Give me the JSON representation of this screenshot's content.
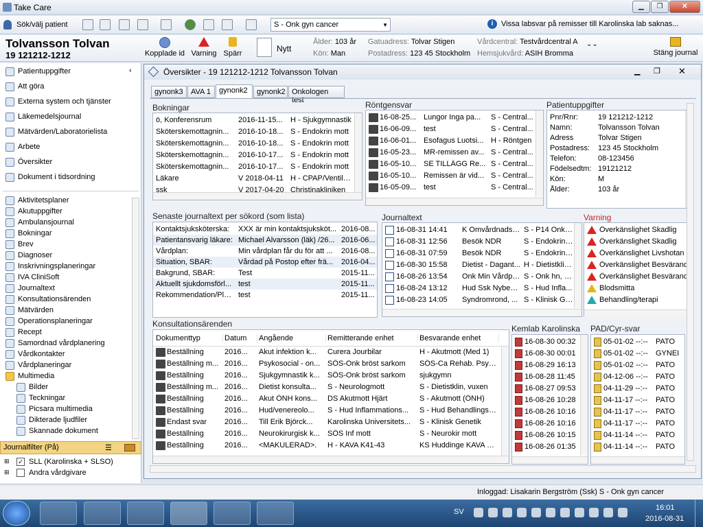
{
  "app": {
    "title": "Take Care"
  },
  "toolbar": {
    "search_patient": "Sök/välj patient",
    "unit": "S - Onk gyn cancer",
    "notice": "Vissa labsvar på remisser till Karolinska lab saknas..."
  },
  "patient": {
    "name": "Tolvansson Tolvan",
    "pnr": "19 121212-1212",
    "linked_id": "Kopplade id",
    "warning": "Varning",
    "lock": "Spärr",
    "new": "Nytt",
    "age_label": "Ålder:",
    "age": "103 år",
    "sex_label": "Kön:",
    "sex": "Man",
    "street_label": "Gatuadress:",
    "street": "Tolvar Stigen",
    "postal_label": "Postadress:",
    "postal": "123 45 Stockholm",
    "center_label": "Vårdcentral:",
    "center": "Testvårdcentral A",
    "home_label": "Hemsjukvård:",
    "home": "ASIH Bromma",
    "close": "Stäng journal"
  },
  "sidebar": {
    "top": [
      "Patientuppgifter",
      "Att göra",
      "Externa system och tjänster",
      "Läkemedelsjournal",
      "Mätvärden/Laboratorielista",
      "Arbete",
      "Översikter",
      "Dokument i tidsordning"
    ],
    "list": [
      "Aktivitetsplaner",
      "Akutuppgifter",
      "Ambulansjournal",
      "Bokningar",
      "Brev",
      "Diagnoser",
      "Inskrivningsplaneringar",
      "IVA CliniSoft",
      "Journaltext",
      "Konsultationsärenden",
      "Mätvärden",
      "Operationsplaneringar",
      "Recept",
      "Samordnad vårdplanering",
      "Vårdkontakter",
      "Vårdplaneringar",
      "Multimedia"
    ],
    "sub": [
      "Bilder",
      "Teckningar",
      "Picsara multimedia",
      "Dikterade ljudfiler",
      "Skannade dokument"
    ],
    "filter_title": "Journalfilter (På)",
    "filters": [
      "SLL (Karolinska + SLSO)",
      "Andra vårdgivare"
    ]
  },
  "window": {
    "title": "Översikter - 19 121212-1212 Tolvansson Tolvan",
    "tabs": [
      "gynonk3",
      "AVA 1",
      "gynonk2",
      "gynonk2",
      "Onkologen test"
    ]
  },
  "bokningar": {
    "title": "Bokningar",
    "rows": [
      [
        "ö, Konferensrum",
        "2016-11-15...",
        "H - Sjukgymnastik"
      ],
      [
        "Sköterskemottagnin...",
        "2016-10-18...",
        "S - Endokrin mott"
      ],
      [
        "Sköterskemottagnin...",
        "2016-10-18...",
        "S - Endokrin mott"
      ],
      [
        "Sköterskemottagnin...",
        "2016-10-17...",
        "S - Endokrin mott"
      ],
      [
        "Sköterskemottagnin...",
        "2016-10-17...",
        "S - Endokrin mott"
      ],
      [
        "Läkare",
        "V 2018-04-11",
        "H - CPAP/Ventila..."
      ],
      [
        "ssk",
        "V 2017-04-20",
        "Christinakliniken"
      ]
    ]
  },
  "rontgen": {
    "title": "Röntgensvar",
    "rows": [
      [
        "16-08-25...",
        "Lungor Inga pa...",
        "S - Central..."
      ],
      [
        "16-06-09...",
        "test",
        "S - Central..."
      ],
      [
        "16-06-01...",
        "Esofagus Luotsi...",
        "H - Röntgen"
      ],
      [
        "16-05-23...",
        "MR-remissen av...",
        "S - Central..."
      ],
      [
        "16-05-10...",
        "SE TILLÄGG Re...",
        "S - Central..."
      ],
      [
        "16-05-10...",
        "Remissen är vid...",
        "S - Central..."
      ],
      [
        "16-05-09...",
        "test",
        "S - Central..."
      ]
    ]
  },
  "patientinfo": {
    "title": "Patientuppgifter",
    "rows": [
      [
        "Pnr/Rnr:",
        "19  121212-1212"
      ],
      [
        "Namn:",
        "Tolvansson Tolvan"
      ],
      [
        "Adress",
        "Tolvar Stigen"
      ],
      [
        "Postadress:",
        "123 45 Stockholm"
      ],
      [
        "Telefon:",
        "08-123456"
      ],
      [
        "Födelsedtm:",
        "19121212"
      ],
      [
        "Kön:",
        "M"
      ],
      [
        "Ålder:",
        "103 år"
      ]
    ]
  },
  "senaste": {
    "title": "Senaste journaltext per sökord (som lista)",
    "rows": [
      [
        "Kontaktsjuksköterska:",
        "XXX är min kontaktsjuksköt...",
        "2016-08..."
      ],
      [
        "Patientansvarig läkare:",
        "Michael Alvarsson (läk) /26...",
        "2016-06..."
      ],
      [
        "Vårdplan:",
        "Min vårdplan får du för att ...",
        "2016-08..."
      ],
      [
        "Situation, SBAR:",
        "Vårdad på Postop efter frä...",
        "2016-04..."
      ],
      [
        "Bakgrund, SBAR:",
        "Test",
        "2015-11..."
      ],
      [
        "Aktuellt sjukdomsförl...",
        "test",
        "2015-11..."
      ],
      [
        "Rekommendation/Pla...",
        "test",
        "2015-11..."
      ]
    ]
  },
  "journaltext": {
    "title": "Journaltext",
    "rows": [
      [
        "16-08-31 14:41",
        "K Omvårdnadsa...",
        "S - P14 Onkol..."
      ],
      [
        "16-08-31 12:56",
        "Besök NDR",
        "S - Endokrin ..."
      ],
      [
        "16-08-31 07:59",
        "Besök NDR",
        "S - Endokrin ..."
      ],
      [
        "16-08-30 15:58",
        "Dietist - Dagant...",
        "H - Dietistklin..."
      ],
      [
        "16-08-26 13:54",
        "Onk Min Vårdplan",
        "S - Onk hn, lu..."
      ],
      [
        "16-08-24 13:12",
        "Hud Ssk Nybesök",
        "S - Hud Infla..."
      ],
      [
        "16-08-23 14:05",
        "Syndromrond, ...",
        "S - Klinisk Gen..."
      ]
    ]
  },
  "varning": {
    "title": "Varning",
    "rows": [
      "Överkänslighet Skadlig",
      "Överkänslighet Skadlig",
      "Överkänslighet Livshotan",
      "Överkänslighet Besvärand",
      "Överkänslighet Besvärand",
      "Blodsmitta",
      "Behandling/terapi"
    ]
  },
  "konsult": {
    "title": "Konsultationsärenden",
    "headers": [
      "Dokumenttyp",
      "Datum",
      "Angående",
      "Remitterande enhet",
      "Besvarande enhet"
    ],
    "rows": [
      [
        "Beställning",
        "2016...",
        "Akut infektion k...",
        "Curera Jourbilar",
        "H - Akutmott (Med 1)"
      ],
      [
        "Beställning m...",
        "2016...",
        "Psykosocial - on...",
        "SÖS-Onk bröst sarkom",
        "SÖS-Ca Rehab. Psyko..."
      ],
      [
        "Beställning",
        "2016...",
        "Sjukgymnastik k...",
        "SÖS-Onk bröst sarkom",
        "sjukgymn"
      ],
      [
        "Beställning m...",
        "2016...",
        "Dietist konsulta...",
        "S - Neurologmott",
        "S - Dietistklin, vuxen"
      ],
      [
        "Beställning",
        "2016...",
        "Akut ÖNH kons...",
        "DS Akutmott Hjärt",
        "S - Akutmott (ÖNH)"
      ],
      [
        "Beställning",
        "2016...",
        "Hud/venereolo...",
        "S - Hud Inflammations...",
        "S - Hud Behandlingscen..."
      ],
      [
        "Endast svar",
        "2016...",
        "Till Erik Björck...",
        "Karolinska Universitets...",
        "S - Klinisk Genetik"
      ],
      [
        "Beställning",
        "2016...",
        "Neurokirurgisk k...",
        "SÖS Inf mott",
        "S - Neurokir mott"
      ],
      [
        "Beställning",
        "2016...",
        "<MAKULERAD>.",
        "H - KAVA K41-43",
        "KS Huddinge KAVA K41..."
      ]
    ]
  },
  "kemlab": {
    "title": "Kemlab Karolinska",
    "rows": [
      "16-08-30 00:32",
      "16-08-30 00:01",
      "16-08-29 16:13",
      "16-08-28 11:45",
      "16-08-27 09:53",
      "16-08-26 10:28",
      "16-08-26 10:16",
      "16-08-26 10:16",
      "16-08-26 10:15",
      "16-08-26 01:35"
    ]
  },
  "pad": {
    "title": "PAD/Cyr-svar",
    "rows": [
      [
        "05-01-02 --:--",
        "PATO"
      ],
      [
        "05-01-02 --:--",
        "GYNEI"
      ],
      [
        "05-01-02 --:--",
        "PATO"
      ],
      [
        "04-12-06 --:--",
        "PATO"
      ],
      [
        "04-11-29 --:--",
        "PATO"
      ],
      [
        "04-11-17 --:--",
        "PATO"
      ],
      [
        "04-11-17 --:--",
        "PATO"
      ],
      [
        "04-11-17 --:--",
        "PATO"
      ],
      [
        "04-11-14 --:--",
        "PATO"
      ],
      [
        "04-11-14 --:--",
        "PATO"
      ]
    ]
  },
  "status": {
    "logged_in": "Inloggad:  Lisakarin Bergström (Ssk) S - Onk gyn cancer"
  },
  "taskbar": {
    "lang": "SV",
    "time": "16:01",
    "date": "2016-08-31"
  }
}
